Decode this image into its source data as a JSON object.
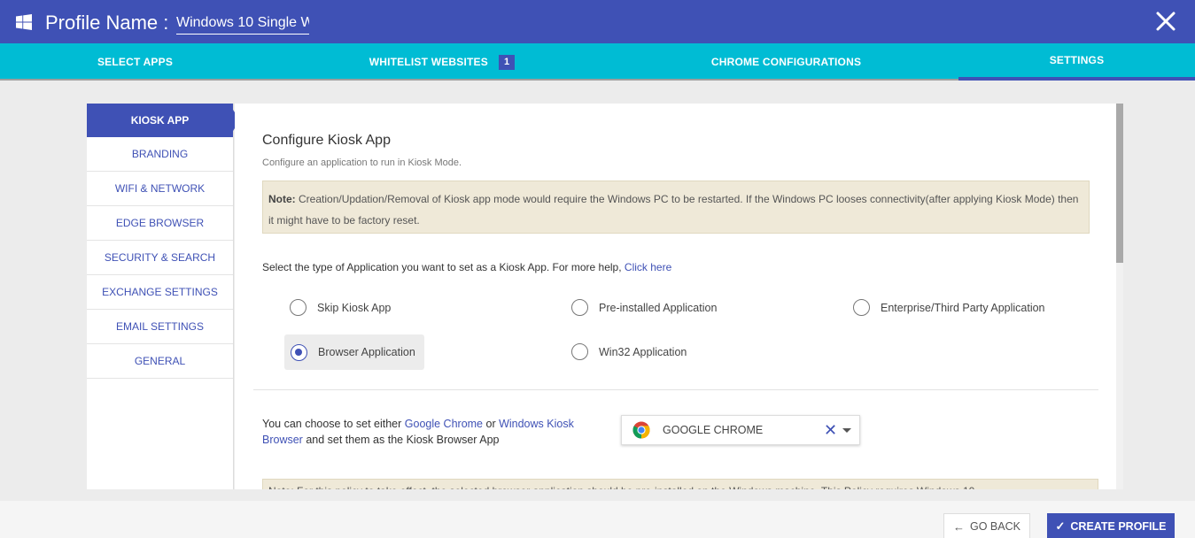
{
  "header": {
    "profile_label": "Profile Name :",
    "profile_value": "Windows 10 Single W",
    "close_icon": "close-icon",
    "brand_icon": "windows-icon"
  },
  "tabs": [
    {
      "label": "SELECT APPS"
    },
    {
      "label": "WHITELIST WEBSITES",
      "badge": "1"
    },
    {
      "label": "CHROME CONFIGURATIONS"
    },
    {
      "label": "SETTINGS",
      "active": true
    }
  ],
  "sidebar": {
    "items": [
      {
        "label": "KIOSK APP",
        "active": true
      },
      {
        "label": "BRANDING"
      },
      {
        "label": "WIFI & NETWORK"
      },
      {
        "label": "EDGE BROWSER"
      },
      {
        "label": "SECURITY & SEARCH"
      },
      {
        "label": "EXCHANGE SETTINGS"
      },
      {
        "label": "EMAIL SETTINGS"
      },
      {
        "label": "GENERAL"
      }
    ]
  },
  "main": {
    "title": "Configure Kiosk App",
    "subtitle": "Configure an application to run in Kiosk Mode.",
    "note_label": "Note:",
    "note_text": " Creation/Updation/Removal of Kiosk app mode would require the Windows PC to be restarted. If the Windows PC looses connectivity(after applying Kiosk Mode) then it might have to be factory reset.",
    "select_prompt": "Select the type of Application you want to set as a Kiosk App. For more help, ",
    "help_link": "Click here",
    "options": [
      {
        "label": "Skip Kiosk App",
        "checked": false
      },
      {
        "label": "Pre-installed Application",
        "checked": false
      },
      {
        "label": "Enterprise/Third Party Application",
        "checked": false
      },
      {
        "label": "Browser Application",
        "checked": true
      },
      {
        "label": "Win32 Application",
        "checked": false
      }
    ],
    "browser_text_1": "You can choose to set either ",
    "browser_link_1": "Google Chrome",
    "browser_text_2": " or ",
    "browser_link_2": "Windows Kiosk Browser",
    "browser_text_3": " and set them as the Kiosk Browser App",
    "dropdown_value": "GOOGLE CHROME",
    "note2_text": "Note: For this policy to take effect, the selected browser application should be pre-installed on the Windows machine. This Policy requires Windows 10"
  },
  "footer": {
    "back_label": "GO BACK",
    "create_label": "CREATE PROFILE"
  },
  "colors": {
    "primary": "#3f51b5",
    "tabbar": "#00bcd4",
    "note_bg": "#efe9d8"
  }
}
